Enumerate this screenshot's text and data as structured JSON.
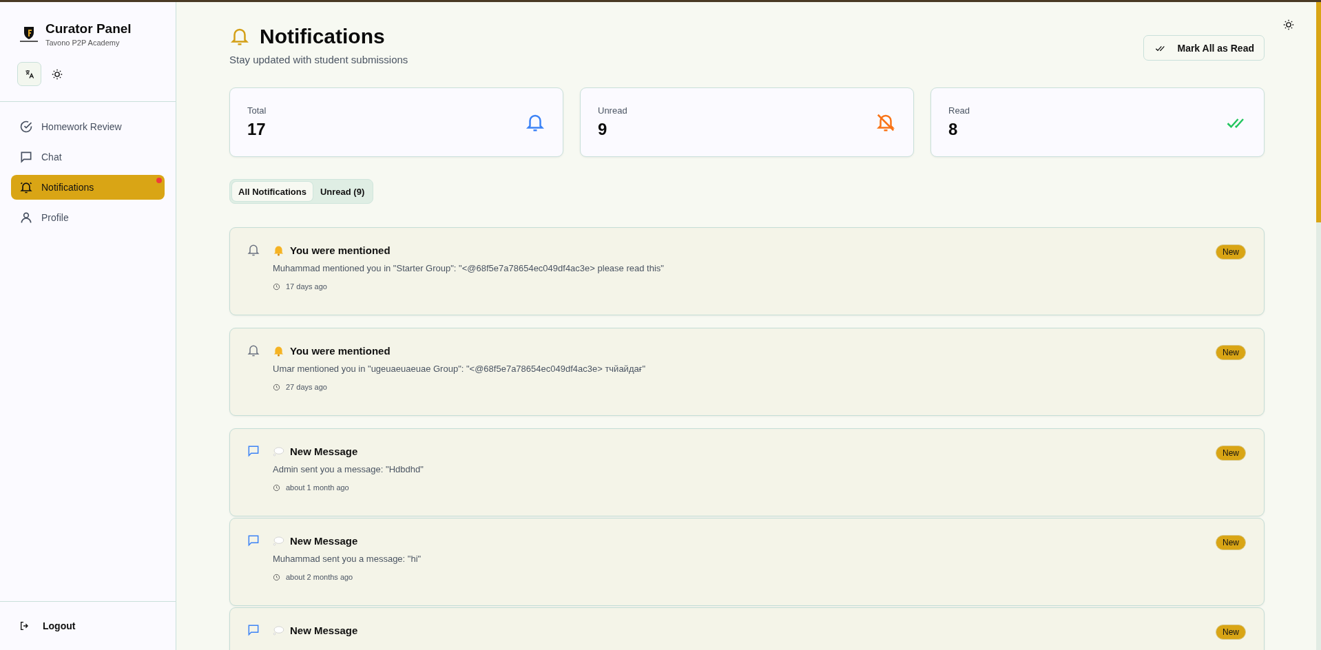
{
  "sidebar": {
    "title": "Curator Panel",
    "subtitle": "Tavono P2P Academy",
    "items": [
      {
        "label": "Homework Review",
        "kind": "homework",
        "selected": false,
        "dot": false
      },
      {
        "label": "Chat",
        "kind": "chat",
        "selected": false,
        "dot": false
      },
      {
        "label": "Notifications",
        "kind": "notifications",
        "selected": true,
        "dot": true
      },
      {
        "label": "Profile",
        "kind": "profile",
        "selected": false,
        "dot": false
      }
    ],
    "logout": "Logout"
  },
  "header": {
    "title": "Notifications",
    "subtitle": "Stay updated with student submissions",
    "button": "Mark All as Read"
  },
  "stats": [
    {
      "label": "Total",
      "value": "17",
      "kind": "total"
    },
    {
      "label": "Unread",
      "value": "9",
      "kind": "unread"
    },
    {
      "label": "Read",
      "value": "8",
      "kind": "read"
    }
  ],
  "tabs": [
    {
      "label": "All Notifications",
      "selected": true
    },
    {
      "label": "Unread (9)",
      "selected": false
    }
  ],
  "notifications": [
    {
      "kind": "mention",
      "title": "You were mentioned",
      "text": "Muhammad mentioned you in \"Starter Group\": \"<@68f5e7a78654ec049df4ac3e> please read this\"",
      "time": "17 days ago",
      "badge": "New",
      "unread": true
    },
    {
      "kind": "mention",
      "title": "You were mentioned",
      "text": "Umar mentioned you in \"ugeuaeuaeuae Group\": \"<@68f5e7a78654ec049df4ac3e> тчйайдағ\"",
      "time": "27 days ago",
      "badge": "New",
      "unread": true
    },
    {
      "kind": "message",
      "title": "New Message",
      "text": "Admin sent you a message: \"Hdbdhd\"",
      "time": "about 1 month ago",
      "badge": "New",
      "unread": true
    },
    {
      "kind": "message",
      "title": "New Message",
      "text": "Muhammad sent you a message: \"hi\"",
      "time": "about 2 months ago",
      "badge": "New",
      "unread": true
    },
    {
      "kind": "message",
      "title": "New Message",
      "badge": "New",
      "unread": true
    }
  ]
}
